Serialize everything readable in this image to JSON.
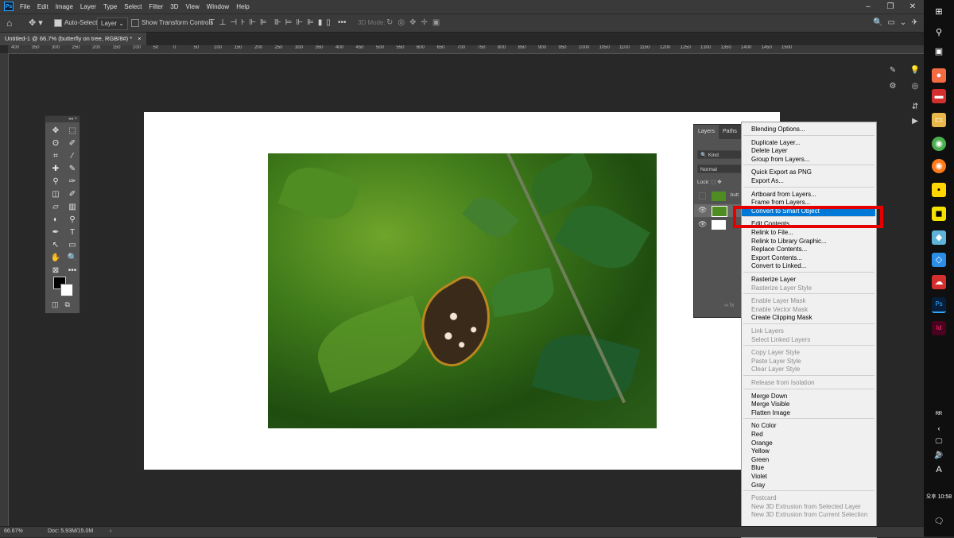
{
  "app": {
    "logo": "Ps",
    "menu": [
      "File",
      "Edit",
      "Image",
      "Layer",
      "Type",
      "Select",
      "Filter",
      "3D",
      "View",
      "Window",
      "Help"
    ],
    "window_buttons": [
      "–",
      "❐",
      "✕"
    ]
  },
  "options_bar": {
    "auto_select_label": "Auto-Select:",
    "auto_select_value": "Layer",
    "show_transform_label": "Show Transform Controls",
    "mode_3d_label": "3D Mode:",
    "more": "•••"
  },
  "document": {
    "tab_title": "Untitled-1 @ 66.7% (butterfly on tree, RGB/8#) *",
    "close": "×"
  },
  "ruler": {
    "ticks": [
      "400",
      "350",
      "300",
      "250",
      "200",
      "150",
      "100",
      "50",
      "0",
      "50",
      "100",
      "150",
      "200",
      "250",
      "300",
      "350",
      "400",
      "450",
      "500",
      "550",
      "600",
      "650",
      "700",
      "750",
      "800",
      "850",
      "900",
      "950",
      "1000",
      "1050",
      "1100",
      "1150",
      "1200",
      "1250",
      "1300",
      "1350",
      "1400",
      "1450",
      "1500"
    ]
  },
  "toolbox": {
    "collapse": "◂◂ ×",
    "tools": [
      "✥",
      "⬚",
      "ʘ",
      "✐",
      "⌗",
      "⁄",
      "✚",
      "✎",
      "⚲",
      "✑",
      "◫",
      "✐",
      "▱",
      "▥",
      "◐",
      "⚲",
      "✒",
      "T",
      "↖",
      "▭",
      "✋",
      "🔍",
      "⊠",
      "•••"
    ]
  },
  "layers_panel": {
    "tabs": [
      "Layers",
      "Paths"
    ],
    "kind_label": "Kind",
    "blend_mode": "Normal",
    "lock_label": "Lock:",
    "layer_names": [
      "butt",
      "",
      ""
    ]
  },
  "context_menu": {
    "items": [
      {
        "label": "Blending Options...",
        "disabled": false
      },
      {
        "sep": true
      },
      {
        "label": "Duplicate Layer...",
        "disabled": false
      },
      {
        "label": "Delete Layer",
        "disabled": false
      },
      {
        "label": "Group from Layers...",
        "disabled": false
      },
      {
        "sep": true
      },
      {
        "label": "Quick Export as PNG",
        "disabled": false
      },
      {
        "label": "Export As...",
        "disabled": false
      },
      {
        "sep": true
      },
      {
        "label": "Artboard from Layers...",
        "disabled": false
      },
      {
        "label": "Frame from Layers...",
        "disabled": false
      },
      {
        "label": "Convert to Smart Object",
        "disabled": false,
        "selected": true
      },
      {
        "sep": true
      },
      {
        "label": "Edit Contents",
        "disabled": false
      },
      {
        "label": "Relink to File...",
        "disabled": false
      },
      {
        "label": "Relink to Library Graphic...",
        "disabled": false
      },
      {
        "label": "Replace Contents...",
        "disabled": false
      },
      {
        "label": "Export Contents...",
        "disabled": false
      },
      {
        "label": "Convert to Linked...",
        "disabled": false
      },
      {
        "sep": true
      },
      {
        "label": "Rasterize Layer",
        "disabled": false
      },
      {
        "label": "Rasterize Layer Style",
        "disabled": true
      },
      {
        "sep": true
      },
      {
        "label": "Enable Layer Mask",
        "disabled": true
      },
      {
        "label": "Enable Vector Mask",
        "disabled": true
      },
      {
        "label": "Create Clipping Mask",
        "disabled": false
      },
      {
        "sep": true
      },
      {
        "label": "Link Layers",
        "disabled": true
      },
      {
        "label": "Select Linked Layers",
        "disabled": true
      },
      {
        "sep": true
      },
      {
        "label": "Copy Layer Style",
        "disabled": true
      },
      {
        "label": "Paste Layer Style",
        "disabled": true
      },
      {
        "label": "Clear Layer Style",
        "disabled": true
      },
      {
        "sep": true
      },
      {
        "label": "Release from Isolation",
        "disabled": true
      },
      {
        "sep": true
      },
      {
        "label": "Merge Down",
        "disabled": false
      },
      {
        "label": "Merge Visible",
        "disabled": false
      },
      {
        "label": "Flatten Image",
        "disabled": false
      },
      {
        "sep": true
      },
      {
        "label": "No Color",
        "disabled": false
      },
      {
        "label": "Red",
        "disabled": false
      },
      {
        "label": "Orange",
        "disabled": false
      },
      {
        "label": "Yellow",
        "disabled": false
      },
      {
        "label": "Green",
        "disabled": false
      },
      {
        "label": "Blue",
        "disabled": false
      },
      {
        "label": "Violet",
        "disabled": false
      },
      {
        "label": "Gray",
        "disabled": false
      },
      {
        "sep": true
      },
      {
        "label": "Postcard",
        "disabled": true
      },
      {
        "label": "New 3D Extrusion from Selected Layer",
        "disabled": true
      },
      {
        "label": "New 3D Extrusion from Current Selection",
        "disabled": true
      }
    ]
  },
  "status_bar": {
    "zoom": "66.67%",
    "doc_info": "Doc: 5.93M/15.0M",
    "arrow": "›"
  },
  "taskbar": {
    "time": "오후 10:58",
    "lang": "A",
    "ps_label": "Ps",
    "id_label": "Id"
  },
  "colors": {
    "highlight": "#0078d7",
    "annotation": "#e50000",
    "ps_blue": "#31a8ff"
  }
}
